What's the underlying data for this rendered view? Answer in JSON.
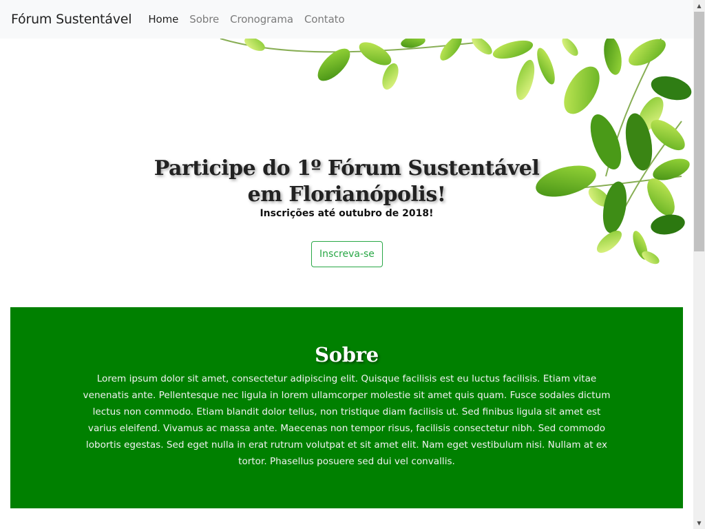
{
  "navbar": {
    "brand": "Fórum Sustentável",
    "links": [
      {
        "label": "Home",
        "active": true
      },
      {
        "label": "Sobre",
        "active": false
      },
      {
        "label": "Cronograma",
        "active": false
      },
      {
        "label": "Contato",
        "active": false
      }
    ]
  },
  "hero": {
    "title_line1": "Participe do 1º Fórum Sustentável",
    "title_line2": "em Florianópolis!",
    "subtitle": "Inscrições até outubro de 2018!",
    "button_label": "Inscreva-se",
    "decor_icon": "green-leaves",
    "button_color": "#28a745"
  },
  "sobre": {
    "heading": "Sobre",
    "body": "Lorem ipsum dolor sit amet, consectetur adipiscing elit. Quisque facilisis est eu luctus facilisis. Etiam vitae venenatis ante. Pellentesque nec ligula in lorem ullamcorper molestie sit amet quis quam. Fusce sodales dictum lectus non commodo. Etiam blandit dolor tellus, non tristique diam facilisis ut. Sed finibus ligula sit amet est varius eleifend. Vivamus ac massa ante. Maecenas non tempor risus, facilisis consectetur nibh. Sed commodo lobortis egestas. Sed eget nulla in erat rutrum volutpat et sit amet elit. Nam eget vestibulum nisi. Nullam at ex tortor. Phasellus posuere sed dui vel convallis.",
    "background_color": "#008000"
  }
}
